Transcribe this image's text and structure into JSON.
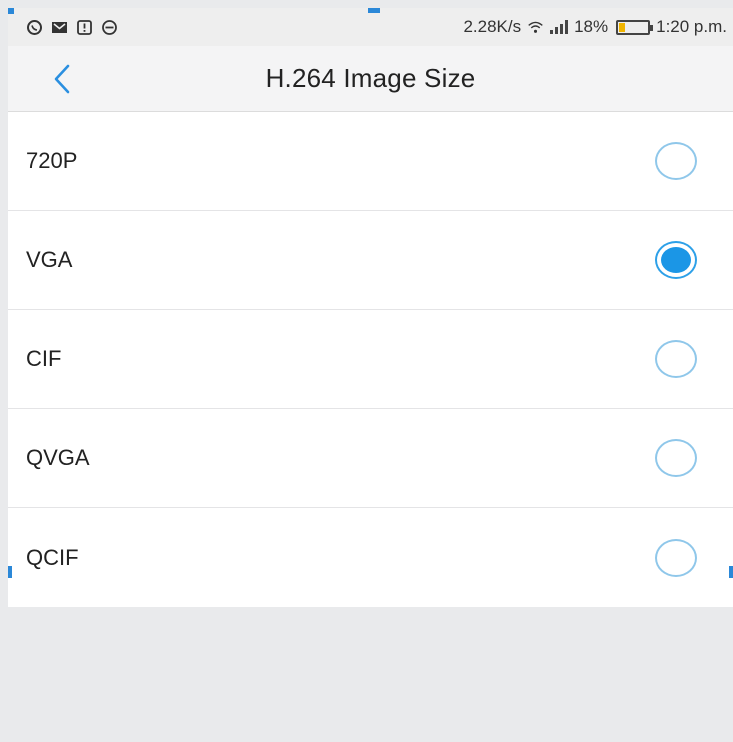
{
  "status_bar": {
    "network_speed": "2.28K/s",
    "battery_percent": "18%",
    "battery_level": 0.18,
    "time": "1:20 p.m.",
    "left_icons": [
      "whatsapp-icon",
      "gmail-icon",
      "alert-icon",
      "do-not-disturb-icon"
    ]
  },
  "header": {
    "title": "H.264 Image Size"
  },
  "options": {
    "items": [
      {
        "label": "720P",
        "selected": false
      },
      {
        "label": "VGA",
        "selected": true
      },
      {
        "label": "CIF",
        "selected": false
      },
      {
        "label": "QVGA",
        "selected": false
      },
      {
        "label": "QCIF",
        "selected": false
      }
    ]
  },
  "colors": {
    "accent": "#1b96e6",
    "radio_border": "#8fc7ea",
    "header_bg": "#f4f4f5",
    "page_bg": "#e9eaec"
  }
}
